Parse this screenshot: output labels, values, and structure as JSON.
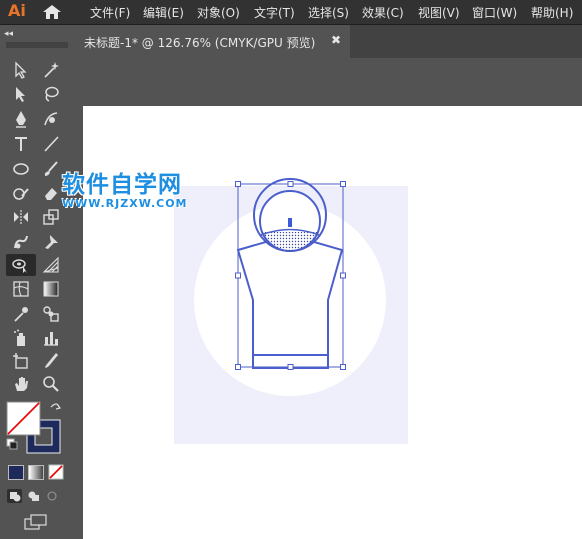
{
  "app": {
    "logo": "Ai"
  },
  "menubar": {
    "items": [
      "文件(F)",
      "编辑(E)",
      "对象(O)",
      "文字(T)",
      "选择(S)",
      "效果(C)",
      "视图(V)",
      "窗口(W)",
      "帮助(H)"
    ]
  },
  "toolbar": {
    "collapse_glyph": "◂◂"
  },
  "document": {
    "tab_title": "未标题-1* @ 126.76% (CMYK/GPU 预览)",
    "close_glyph": "✖"
  },
  "watermark": {
    "title": "软件自学网",
    "url": "WWW.RJZXW.COM"
  },
  "colors": {
    "app_bg": "#535353",
    "menubar_bg": "#323232",
    "accent_logo": "#E8742B",
    "artwork_stroke": "#4B5FCC",
    "artwork_bg_square": "#EEEFFA",
    "stroke_swatch": "#1E2A5C",
    "watermark": "#1E8FE0"
  }
}
